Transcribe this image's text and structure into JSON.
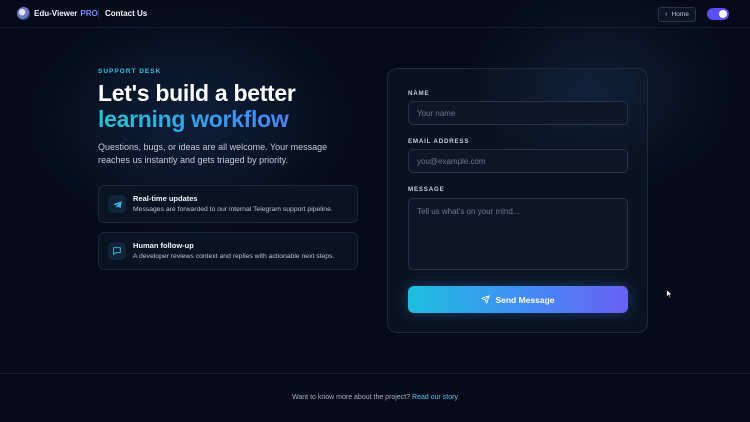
{
  "header": {
    "brand_name": "Edu-Viewer",
    "brand_badge": "PRO",
    "nav_active": "Contact Us",
    "home_button": "Home",
    "theme_toggle_on": true
  },
  "hero": {
    "eyebrow": "SUPPORT DESK",
    "headline_line1": "Let's build a better",
    "headline_line2": "learning workflow",
    "lead": "Questions, bugs, or ideas are all welcome. Your message reaches us instantly and gets triaged by priority."
  },
  "features": [
    {
      "icon": "telegram-icon",
      "title": "Real-time updates",
      "description": "Messages are forwarded to our internal Telegram support pipeline."
    },
    {
      "icon": "chat-icon",
      "title": "Human follow-up",
      "description": "A developer reviews context and replies with actionable next steps."
    }
  ],
  "form": {
    "name_label": "NAME",
    "name_placeholder": "Your name",
    "name_value": "",
    "email_label": "EMAIL ADDRESS",
    "email_placeholder": "you@example.com",
    "email_value": "",
    "message_label": "MESSAGE",
    "message_placeholder": "Tell us what's on your mind...",
    "message_value": "",
    "submit_label": "Send Message"
  },
  "footer": {
    "text": "Want to know more about the project?",
    "link_label": "Read our story"
  },
  "colors": {
    "background": "#050b18",
    "accent_cyan": "#22c6d6",
    "accent_blue": "#3f8ff6",
    "accent_violet": "#6a5ff4"
  }
}
